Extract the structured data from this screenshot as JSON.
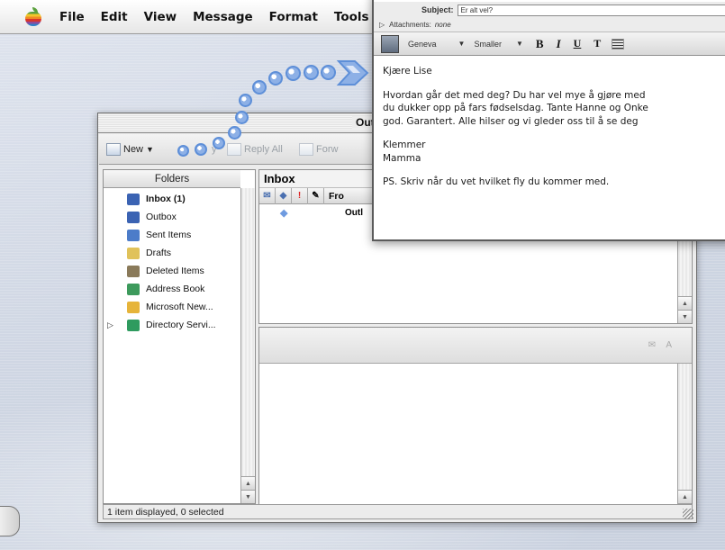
{
  "menubar": {
    "items": [
      "File",
      "Edit",
      "View",
      "Message",
      "Format",
      "Tools"
    ]
  },
  "outlook": {
    "title": "Out",
    "toolbar": {
      "new_label": "New",
      "reply_label": "y",
      "reply_all_label": "Reply All",
      "forward_label": "Forw"
    },
    "folders_header": "Folders",
    "folders": [
      {
        "label": "Inbox (1)",
        "color": "#3b63b3"
      },
      {
        "label": "Outbox",
        "color": "#3b63b3"
      },
      {
        "label": "Sent Items",
        "color": "#4c7cc9"
      },
      {
        "label": "Drafts",
        "color": "#e0c25a"
      },
      {
        "label": "Deleted Items",
        "color": "#8a7a5a"
      },
      {
        "label": "Address Book",
        "color": "#3d9a5c"
      },
      {
        "label": "Microsoft New...",
        "color": "#e6b43a"
      },
      {
        "label": "Directory Servi...",
        "color": "#2f9b5f"
      }
    ],
    "inbox": {
      "title": "Inbox",
      "from_col": "Fro",
      "row_text": "Outl"
    },
    "status": "1 item displayed, 0 selected"
  },
  "compose": {
    "subject_label": "Subject:",
    "subject_value": "Er alt vel?",
    "attachments_label": "Attachments:",
    "attachments_value": "none",
    "font_name": "Geneva",
    "font_size": "Smaller",
    "format_b": "B",
    "format_i": "I",
    "format_u": "U",
    "format_t": "T",
    "body": {
      "greeting": "Kjære Lise",
      "line1": "Hvordan går det med deg? Du har vel mye å gjøre med",
      "line2": "du dukker opp på fars fødselsdag. Tante Hanne og Onke",
      "line3": "god. Garantert. Alle hilser og vi gleder oss til å se deg",
      "sign1": "Klemmer",
      "sign2": "Mamma",
      "ps": "PS. Skriv når du vet hvilket fly du kommer med."
    }
  },
  "colors": {
    "accent_arrow": "#6f9be0"
  }
}
